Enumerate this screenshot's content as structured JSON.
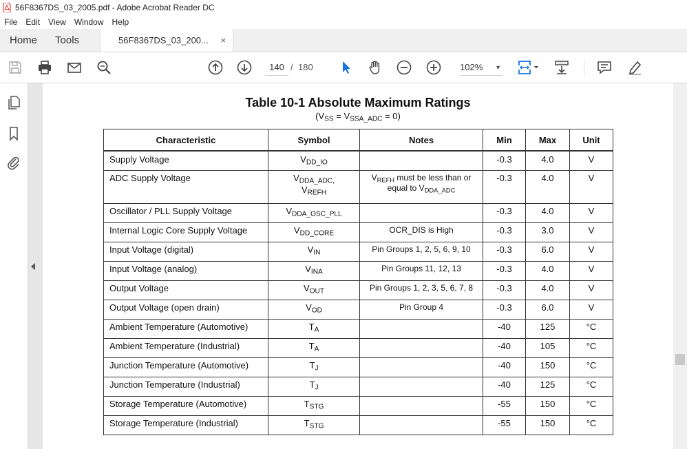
{
  "window": {
    "title": "56F8367DS_03_2005.pdf - Adobe Acrobat Reader DC"
  },
  "menu": [
    "File",
    "Edit",
    "View",
    "Window",
    "Help"
  ],
  "tabs": {
    "home": "Home",
    "tools": "Tools",
    "document": "56F8367DS_03_200...",
    "close": "×"
  },
  "toolbar": {
    "current_page": "140",
    "page_separator": "/",
    "total_pages": "180",
    "zoom": "102%",
    "zoom_caret": "▼"
  },
  "document": {
    "title": "Table 10-1 Absolute Maximum Ratings",
    "subtitle_parts": [
      "(V",
      "SS",
      " = V",
      "SSA_ADC",
      " = 0)"
    ],
    "columns": [
      "Characteristic",
      "Symbol",
      "Notes",
      "Min",
      "Max",
      "Unit"
    ],
    "rows": [
      {
        "characteristic": "Supply Voltage",
        "sym": "V",
        "sym_sub": "DD_IO",
        "notes": "",
        "min": "-0.3",
        "max": "4.0",
        "unit": "V"
      },
      {
        "characteristic": "ADC Supply Voltage",
        "sym": "V",
        "sym_sub": "DDA_ADC,",
        "sym2": "V",
        "sym2_sub": "REFH",
        "notes_a": "V",
        "notes_a_sub": "REFH",
        "notes_b": " must be less than or equal to V",
        "notes_b_sub": "DDA_ADC",
        "min": "-0.3",
        "max": "4.0",
        "unit": "V"
      },
      {
        "characteristic": "Oscillator / PLL Supply Voltage",
        "sym": "V",
        "sym_sub": "DDA_OSC_PLL",
        "notes": "",
        "min": "-0.3",
        "max": "4.0",
        "unit": "V"
      },
      {
        "characteristic": "Internal Logic Core Supply Voltage",
        "sym": "V",
        "sym_sub": "DD_CORE",
        "notes": "OCR_DIS is High",
        "min": "-0.3",
        "max": "3.0",
        "unit": "V"
      },
      {
        "characteristic": "Input Voltage (digital)",
        "sym": "V",
        "sym_sub": "IN",
        "notes": "Pin Groups 1, 2, 5, 6, 9, 10",
        "min": "-0.3",
        "max": "6.0",
        "unit": "V"
      },
      {
        "characteristic": "Input Voltage (analog)",
        "sym": "V",
        "sym_sub": "INA",
        "notes": "Pin Groups 11, 12, 13",
        "min": "-0.3",
        "max": "4.0",
        "unit": "V"
      },
      {
        "characteristic": "Output Voltage",
        "sym": "V",
        "sym_sub": "OUT",
        "notes": "Pin Groups 1, 2, 3, 5, 6, 7, 8",
        "min": "-0.3",
        "max": "4.0",
        "unit": "V"
      },
      {
        "characteristic": "Output Voltage (open drain)",
        "sym": "V",
        "sym_sub": "OD",
        "notes": "Pin Group 4",
        "min": "-0.3",
        "max": "6.0",
        "unit": "V"
      },
      {
        "characteristic": "Ambient Temperature (Automotive)",
        "sym": "T",
        "sym_sub": "A",
        "notes": "",
        "min": "-40",
        "max": "125",
        "unit": "°C"
      },
      {
        "characteristic": "Ambient Temperature (Industrial)",
        "sym": "T",
        "sym_sub": "A",
        "notes": "",
        "min": "-40",
        "max": "105",
        "unit": "°C"
      },
      {
        "characteristic": "Junction Temperature (Automotive)",
        "sym": "T",
        "sym_sub": "J",
        "notes": "",
        "min": "-40",
        "max": "150",
        "unit": "°C"
      },
      {
        "characteristic": "Junction Temperature (Industrial)",
        "sym": "T",
        "sym_sub": "J",
        "notes": "",
        "min": "-40",
        "max": "125",
        "unit": "°C"
      },
      {
        "characteristic": "Storage Temperature (Automotive)",
        "sym": "T",
        "sym_sub": "STG",
        "notes": "",
        "min": "-55",
        "max": "150",
        "unit": "°C"
      },
      {
        "characteristic": "Storage Temperature (Industrial)",
        "sym": "T",
        "sym_sub": "STG",
        "notes": "",
        "min": "-55",
        "max": "150",
        "unit": "°C"
      }
    ]
  },
  "icons": {
    "app": "pdf-file-icon",
    "save": "save-icon",
    "print": "print-icon",
    "email": "email-icon",
    "search": "search-zoom-icon",
    "prev": "previous-page-icon",
    "next": "next-page-icon",
    "select": "select-cursor-icon",
    "hand": "hand-tool-icon",
    "zoom_out": "zoom-out-icon",
    "zoom_in": "zoom-in-icon",
    "fit": "fit-page-icon",
    "scroll": "scroll-mode-icon",
    "comment": "comment-icon",
    "highlight": "highlight-pen-icon",
    "pages": "page-thumbnails-icon",
    "bookmarks": "bookmark-icon",
    "attachments": "attachment-icon"
  },
  "colors": {
    "accent_blue": "#1473e6",
    "pdf_red": "#d8241f"
  }
}
